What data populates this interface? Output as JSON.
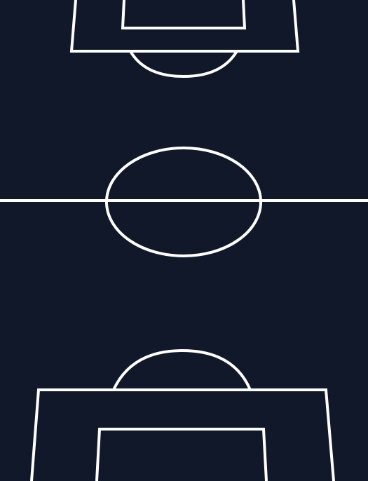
{
  "pitch": {
    "background_color": "#11182a",
    "line_color": "#ffffff",
    "view": "perspective",
    "elements": [
      "top-penalty-box",
      "top-goal-box",
      "top-penalty-arc",
      "halfway-line",
      "center-circle",
      "bottom-penalty-arc",
      "bottom-penalty-box",
      "bottom-goal-box"
    ]
  }
}
